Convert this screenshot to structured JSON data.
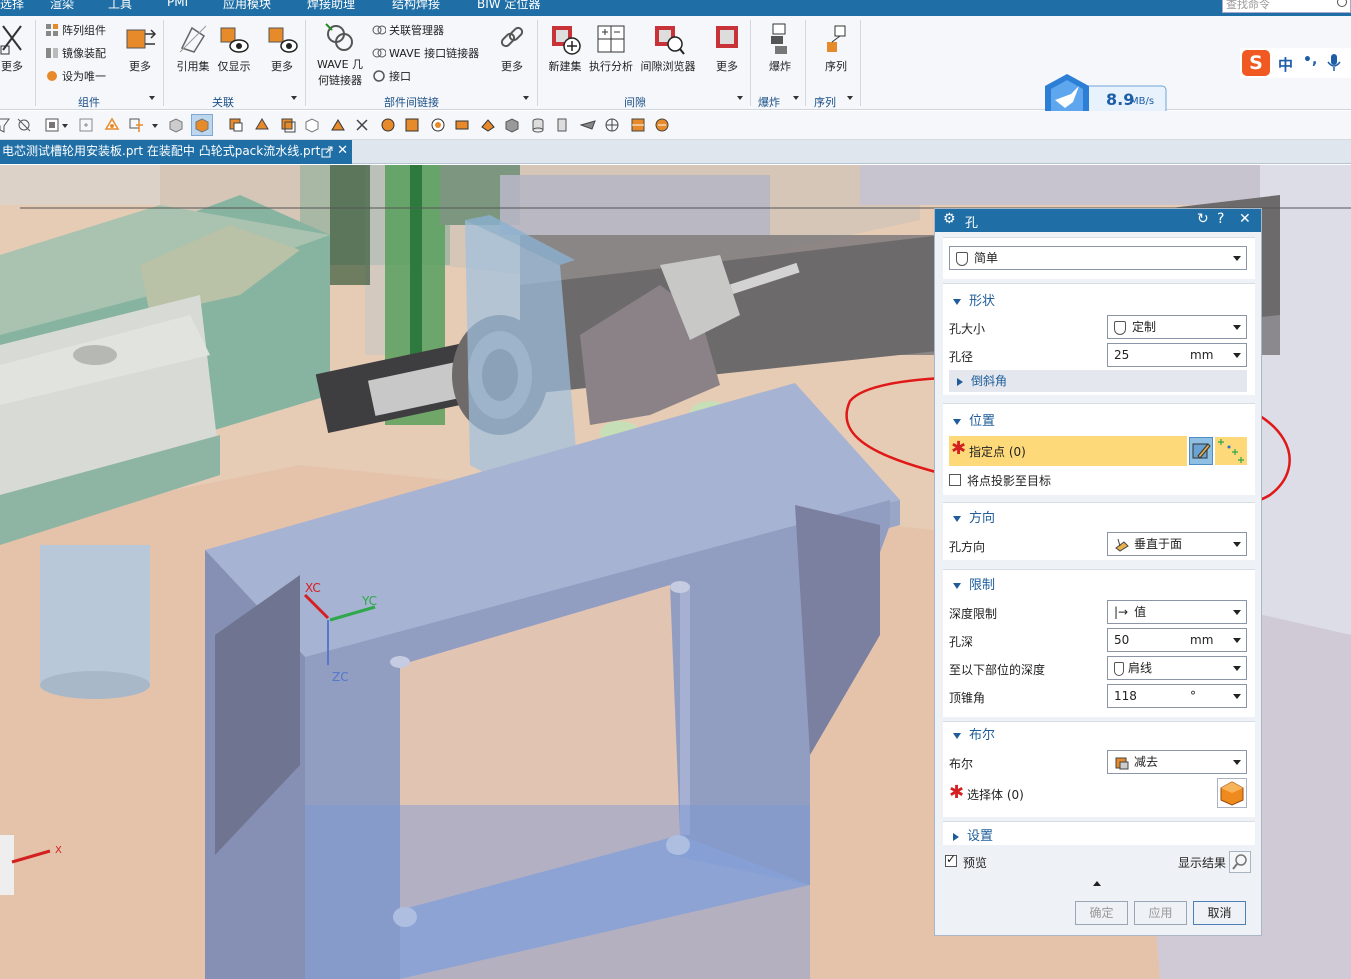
{
  "menubar": {
    "items": [
      "选择",
      "渲染",
      "工具",
      "PMI",
      "应用模块",
      "焊接助理",
      "结构焊接",
      "BIW 定位器"
    ],
    "search_placeholder": "查找命令"
  },
  "ribbon": {
    "more_left": "更多",
    "component": {
      "array": "阵列组件",
      "mirror": "镜像装配",
      "unique": "设为唯一",
      "more": "更多",
      "group": "组件"
    },
    "assoc": {
      "ref_set": "引用集",
      "show_only": "仅显示",
      "more": "更多",
      "group": "关联"
    },
    "wave": {
      "geom1": "WAVE 几",
      "geom2": "何链接器",
      "relation_mgr": "关联管理器",
      "interface_linker": "WAVE 接口链接器",
      "interface": "接口",
      "more": "更多",
      "group": "部件间链接"
    },
    "clearance": {
      "new_set": "新建集",
      "run": "执行分析",
      "browser": "间隙浏览器",
      "more": "更多",
      "group": "间隙"
    },
    "explode": {
      "label": "爆炸",
      "group": "爆炸"
    },
    "sequence": {
      "label": "序列",
      "group": "序列"
    }
  },
  "network": {
    "speed": "8.9",
    "unit": "MB/s"
  },
  "ime": {
    "lang": "中",
    "punct": "•,"
  },
  "tab": {
    "title": "电芯测试槽轮用安装板.prt 在装配中 凸轮式pack流水线.prt"
  },
  "viewport": {
    "xc": "XC",
    "yc": "YC",
    "zc": "ZC",
    "x": "X"
  },
  "dialog": {
    "title": "孔",
    "type_value": "简单",
    "shape": {
      "title": "形状",
      "size_label": "孔大小",
      "size_value": "定制",
      "diam_label": "孔径",
      "diam_value": "25",
      "diam_unit": "mm",
      "chamfer": "倒斜角"
    },
    "position": {
      "title": "位置",
      "specify_point": "指定点 (0)",
      "project": "将点投影至目标"
    },
    "direction": {
      "title": "方向",
      "label": "孔方向",
      "value": "垂直于面"
    },
    "limit": {
      "title": "限制",
      "depth_limit_label": "深度限制",
      "depth_limit_value": "值",
      "depth_label": "孔深",
      "depth_value": "50",
      "depth_unit": "mm",
      "to_depth_label": "至以下部位的深度",
      "to_depth_value": "肩线",
      "tip_label": "顶锥角",
      "tip_value": "118",
      "tip_unit": "°"
    },
    "boolean": {
      "title": "布尔",
      "label": "布尔",
      "value": "减去",
      "select_body": "选择体 (0)"
    },
    "settings": {
      "title": "设置"
    },
    "preview": "预览",
    "show_result": "显示结果",
    "ok": "确定",
    "apply": "应用",
    "cancel": "取消"
  }
}
